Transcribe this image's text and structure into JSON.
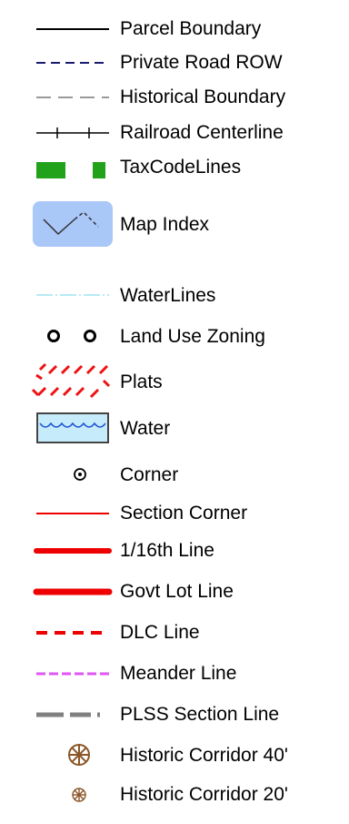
{
  "legend": {
    "items": [
      {
        "label": "Parcel Boundary",
        "icon": "solid-black-line-icon"
      },
      {
        "label": "Private Road ROW",
        "icon": "navy-dashed-line-icon"
      },
      {
        "label": "Historical Boundary",
        "icon": "gray-dashed-line-icon"
      },
      {
        "label": "Railroad Centerline",
        "icon": "railroad-line-icon"
      },
      {
        "label": "TaxCodeLines",
        "icon": "green-bars-icon"
      },
      {
        "label": "Map Index",
        "icon": "map-index-polygon-icon"
      },
      {
        "label": "WaterLines",
        "icon": "light-blue-line-icon"
      },
      {
        "label": "Land Use Zoning",
        "icon": "black-circles-icon"
      },
      {
        "label": "Plats",
        "icon": "red-hatch-icon"
      },
      {
        "label": "Water",
        "icon": "water-waves-icon"
      },
      {
        "label": "Corner",
        "icon": "dot-circle-icon"
      },
      {
        "label": "Section Corner",
        "icon": "thin-red-line-icon"
      },
      {
        "label": "1/16th Line",
        "icon": "thick-red-line-icon"
      },
      {
        "label": "Govt Lot Line",
        "icon": "thick-red-line-icon"
      },
      {
        "label": "DLC Line",
        "icon": "red-dashed-line-icon"
      },
      {
        "label": "Meander Line",
        "icon": "magenta-dashed-line-icon"
      },
      {
        "label": "PLSS Section Line",
        "icon": "gray-thick-dashed-line-icon"
      },
      {
        "label": "Historic Corridor 40'",
        "icon": "wagon-wheel-icon"
      },
      {
        "label": "Historic Corridor 20'",
        "icon": "small-wagon-wheel-icon"
      }
    ],
    "colors": {
      "parcel": "#000000",
      "private_road": "#1a1a70",
      "historical": "#999999",
      "tax_code": "#22a11a",
      "map_index_fill": "#a9c7f7",
      "water_lines": "#9fe3f0",
      "plats": "#ee1111",
      "water_fill": "#c6ecfb",
      "water_wave": "#1f53d6",
      "red_line": "#ee0000",
      "meander": "#e055f5",
      "plss": "#808080",
      "corridor": "#8b5527"
    }
  }
}
